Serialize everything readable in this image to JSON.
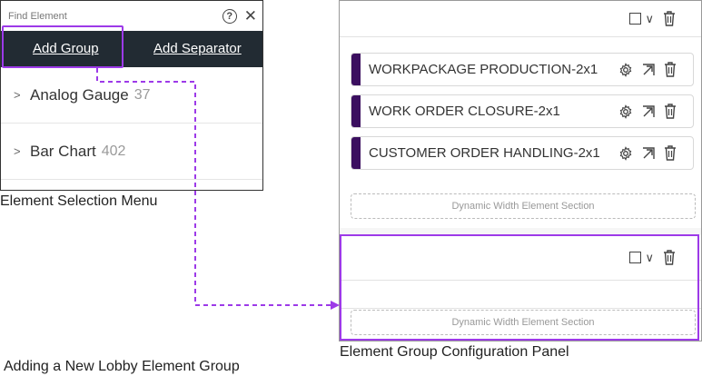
{
  "menu": {
    "title": "Find Element",
    "toolbar": {
      "add_group_label": "Add Group",
      "add_separator_label": "Add Separator"
    },
    "items": [
      {
        "label": "Analog Gauge",
        "count": "37"
      },
      {
        "label": "Bar Chart",
        "count": "402"
      }
    ]
  },
  "captions": {
    "menu": "Element Selection Menu",
    "bottom": "Adding a New Lobby Element Group",
    "panel": "Element Group Configuration Panel"
  },
  "panel": {
    "groups": [
      {
        "elements": [
          {
            "label": "WORKPACKAGE PRODUCTION-2x1"
          },
          {
            "label": "WORK ORDER CLOSURE-2x1"
          },
          {
            "label": "CUSTOMER ORDER HANDLING-2x1"
          }
        ],
        "section_label": "Dynamic Width Element Section"
      },
      {
        "elements": [],
        "section_label": "Dynamic Width Element Section"
      }
    ]
  },
  "colors": {
    "highlight": "#9d3ae8",
    "toolbar_bg": "#222b33",
    "element_accent": "#3b0f5f"
  },
  "icons": {
    "help": "help-icon",
    "close": "close-icon",
    "chevron_right": "chevron-right-icon",
    "checkbox": "checkbox-icon",
    "chevron_down": "chevron-down-icon",
    "trash": "trash-icon",
    "gear": "gear-icon",
    "open": "open-external-icon"
  }
}
